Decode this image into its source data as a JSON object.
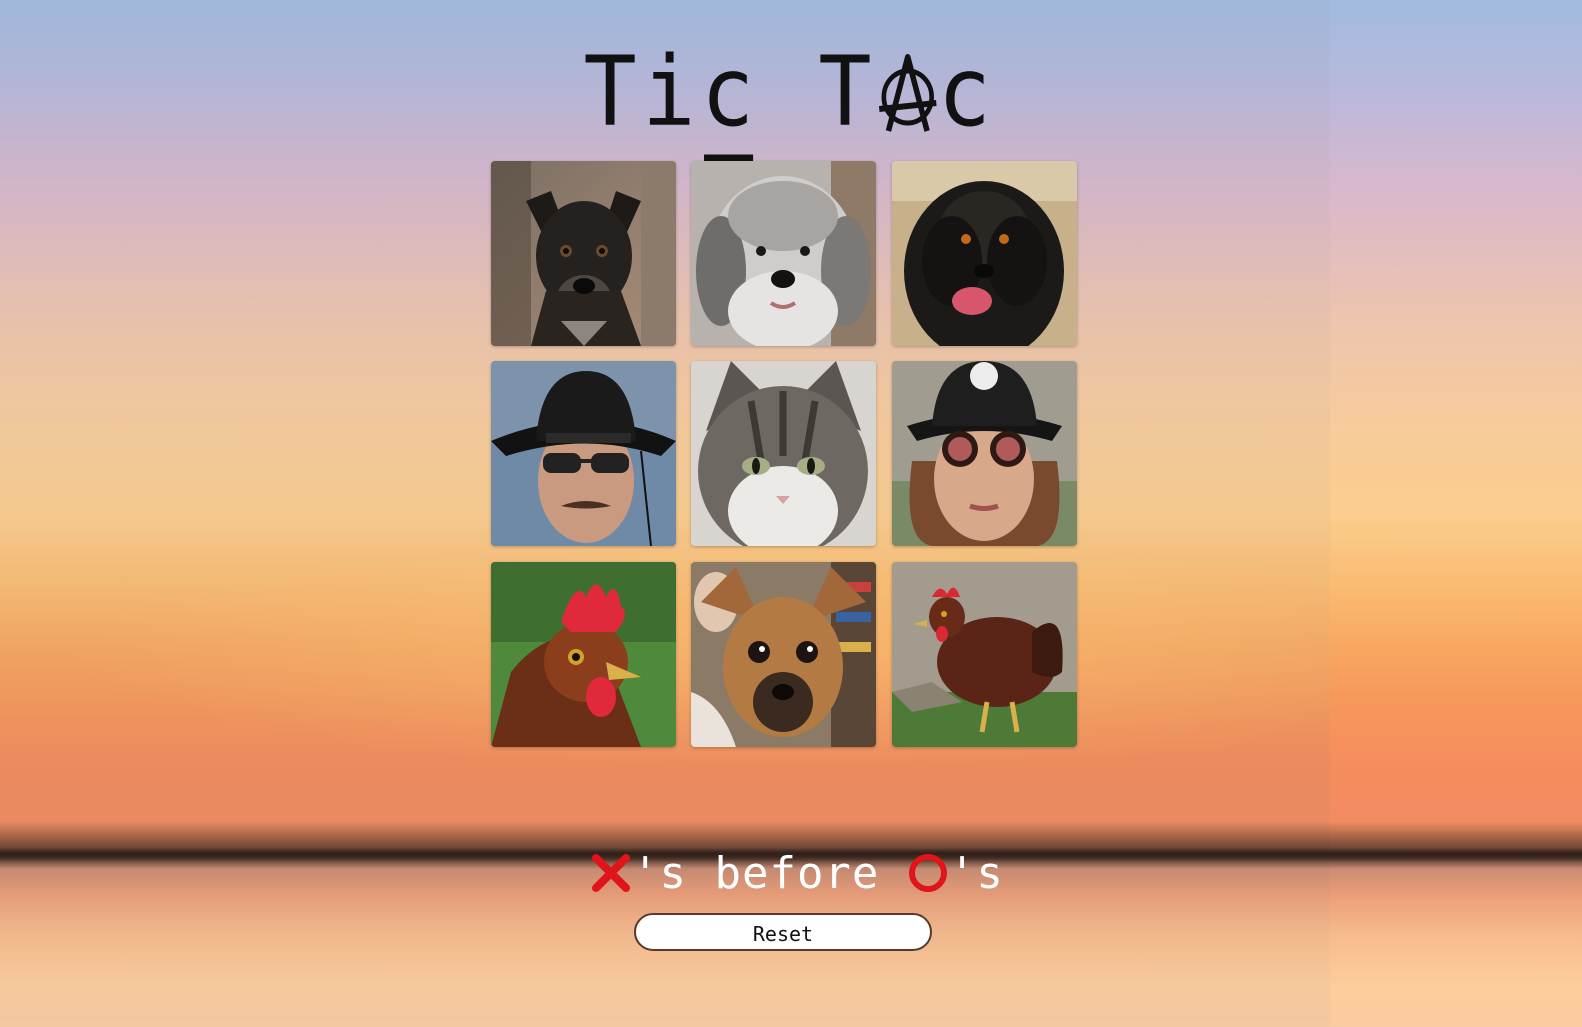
{
  "title": {
    "part1": "Tic",
    "part2_prefix": "T",
    "part2_suffix": "c",
    "part3": "Toe"
  },
  "board": {
    "cells": [
      {
        "subject": "dark brindle dog"
      },
      {
        "subject": "grey curly doodle dog"
      },
      {
        "subject": "black fluffy dog"
      },
      {
        "subject": "man in bucket hat"
      },
      {
        "subject": "tabby cat"
      },
      {
        "subject": "woman in bucket hat"
      },
      {
        "subject": "rooster"
      },
      {
        "subject": "tan chihuahua-mix dog"
      },
      {
        "subject": "brown hen"
      }
    ]
  },
  "status": {
    "text_mid": "'s before ",
    "text_end": "'s"
  },
  "reset": {
    "label": "Reset"
  },
  "colors": {
    "x_mark": "#e0151b",
    "o_mark": "#e0151b",
    "title": "#111111"
  }
}
